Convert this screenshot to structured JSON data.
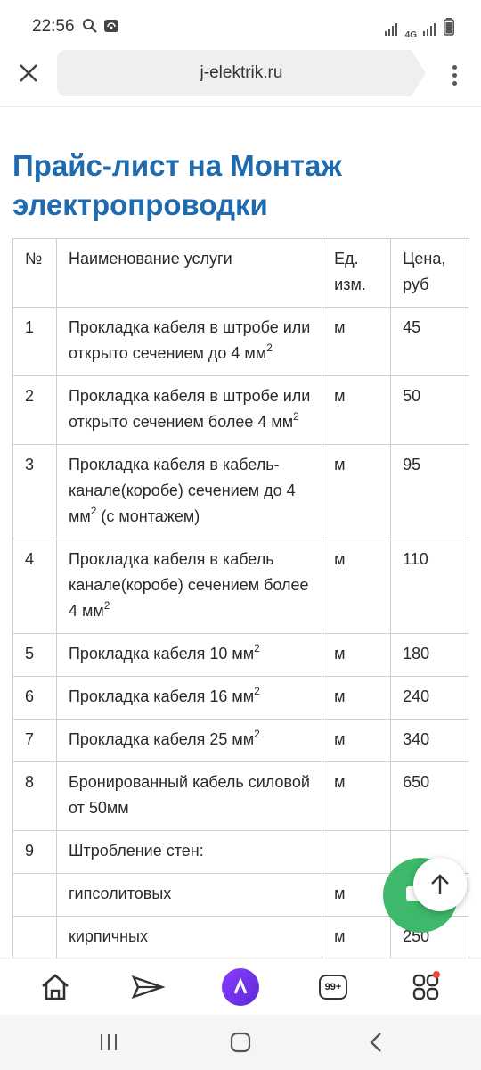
{
  "status_bar": {
    "time": "22:56",
    "network": "4G"
  },
  "browser": {
    "url": "j-elektrik.ru"
  },
  "page": {
    "title": "Прайс-лист на Монтаж электропроводки",
    "table": {
      "header": {
        "num": "№",
        "name": "Наименование услуги",
        "unit": "Ед. изм.",
        "price": "Цена, руб"
      },
      "rows": [
        {
          "num": "1",
          "name_pre": "Прокладка кабеля в штробе или открыто сечением до 4 мм",
          "sup": "2",
          "name_post": "",
          "unit": "м",
          "price": "45"
        },
        {
          "num": "2",
          "name_pre": "Прокладка кабеля в штробе или открыто сечением более 4 мм",
          "sup": "2",
          "name_post": "",
          "unit": "м",
          "price": "50"
        },
        {
          "num": "3",
          "name_pre": "Прокладка кабеля в кабель-канале(коробе) сечением до 4 мм",
          "sup": "2",
          "name_post": " (с монтажем)",
          "unit": "м",
          "price": "95"
        },
        {
          "num": "4",
          "name_pre": "Прокладка кабеля в кабель канале(коробе) сечением более 4 мм",
          "sup": "2",
          "name_post": "",
          "unit": "м",
          "price": "110"
        },
        {
          "num": "5",
          "name_pre": "Прокладка кабеля 10 мм",
          "sup": "2",
          "name_post": "",
          "unit": "м",
          "price": "180"
        },
        {
          "num": "6",
          "name_pre": "Прокладка кабеля 16 мм",
          "sup": "2",
          "name_post": "",
          "unit": "м",
          "price": "240"
        },
        {
          "num": "7",
          "name_pre": "Прокладка кабеля 25 мм",
          "sup": "2",
          "name_post": "",
          "unit": "м",
          "price": "340"
        },
        {
          "num": "8",
          "name_pre": "Бронированный кабель силовой от 50мм",
          "sup": "",
          "name_post": "",
          "unit": "м",
          "price": "650"
        },
        {
          "num": "9",
          "name_pre": "Штробление стен:",
          "sup": "",
          "name_post": "",
          "unit": "",
          "price": ""
        },
        {
          "num": "",
          "name_pre": "гипсолитовых",
          "sup": "",
          "name_post": "",
          "unit": "м",
          "price": ""
        },
        {
          "num": "",
          "name_pre": "кирпичных",
          "sup": "",
          "name_post": "",
          "unit": "м",
          "price": "250"
        }
      ]
    }
  },
  "bottom_nav": {
    "tabs_badge": "99+"
  },
  "icons": {
    "close": "close-icon",
    "menu": "more-vertical-icon",
    "home": "home-icon",
    "send": "paper-plane-icon",
    "alice": "alice-icon",
    "tabs": "tabs-icon",
    "services": "services-icon",
    "scroll_top": "arrow-up-icon"
  },
  "colors": {
    "title": "#1e6bb0",
    "fab": "#3eb86a",
    "alice": "#7b35f0"
  }
}
